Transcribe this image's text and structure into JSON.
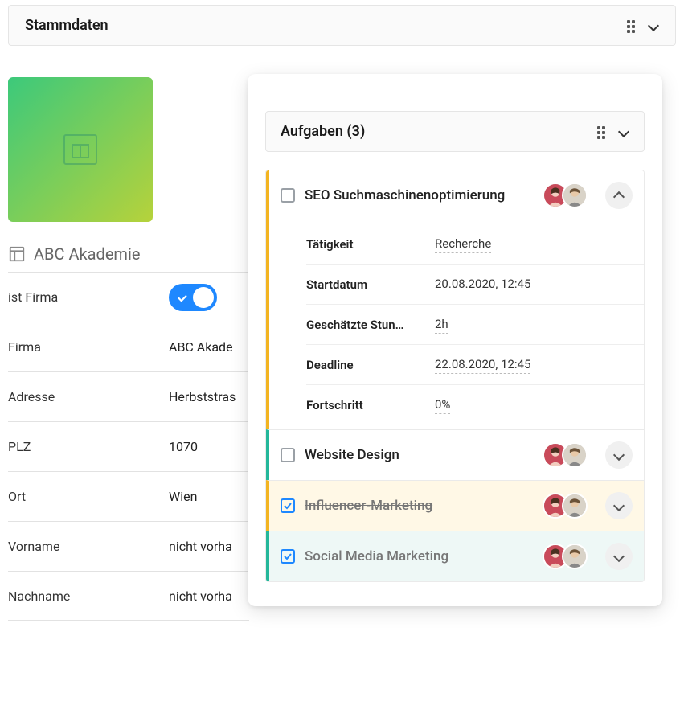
{
  "header": {
    "title": "Stammdaten"
  },
  "company": {
    "name": "ABC Akademie",
    "fields": {
      "ist_firma_label": "ist Firma",
      "firma_label": "Firma",
      "firma_value": "ABC Akade",
      "adresse_label": "Adresse",
      "adresse_value": "Herbststras",
      "plz_label": "PLZ",
      "plz_value": "1070",
      "ort_label": "Ort",
      "ort_value": "Wien",
      "vorname_label": "Vorname",
      "vorname_value": "nicht vorha",
      "nachname_label": "Nachname",
      "nachname_value": "nicht vorha"
    }
  },
  "tasks_panel": {
    "title": "Aufgaben (3)"
  },
  "tasks": [
    {
      "title": "SEO Suchmaschinenoptimierung",
      "details": {
        "taetigkeit_label": "Tätigkeit",
        "taetigkeit_value": "Recherche",
        "startdatum_label": "Startdatum",
        "startdatum_value": "20.08.2020, 12:45",
        "stunden_label": "Geschätzte Stun…",
        "stunden_value": "2h",
        "deadline_label": "Deadline",
        "deadline_value": "22.08.2020, 12:45",
        "fortschritt_label": "Fortschritt",
        "fortschritt_value": "0%"
      }
    },
    {
      "title": "Website Design"
    },
    {
      "title": "Influencer-Marketing"
    },
    {
      "title": "Social Media Marketing"
    }
  ]
}
